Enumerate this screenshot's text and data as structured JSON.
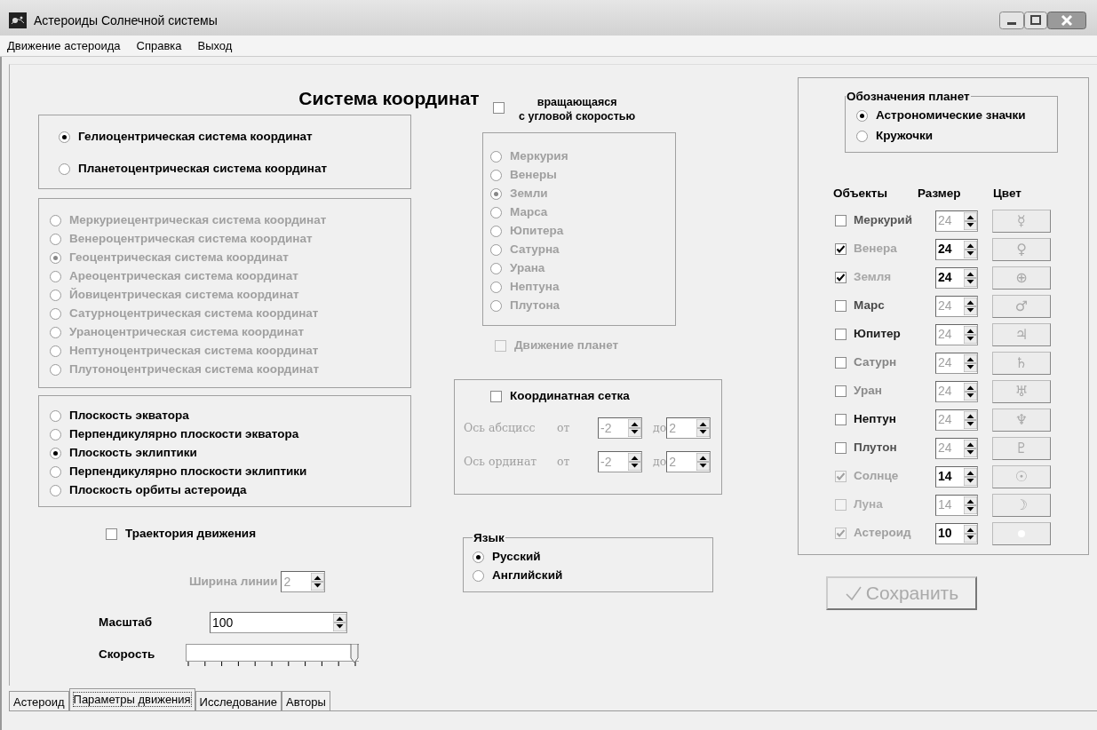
{
  "window": {
    "title": "Астероиды Солнечной системы"
  },
  "menu": [
    "Движение астероида",
    "Справка",
    "Выход"
  ],
  "heading": "Система координат",
  "center_group": {
    "options": [
      {
        "label": "Гелиоцентрическая система координат",
        "selected": true
      },
      {
        "label": "Планетоцентрическая система координат",
        "selected": false
      }
    ]
  },
  "planet_center_group": {
    "disabled": true,
    "options": [
      {
        "label": "Меркуриецентрическая система координат",
        "selected": false
      },
      {
        "label": "Венероцентрическая система координат",
        "selected": false
      },
      {
        "label": "Геоцентрическая система координат",
        "selected": true
      },
      {
        "label": "Ареоцентрическая система координат",
        "selected": false
      },
      {
        "label": "Йовицентрическая система координат",
        "selected": false
      },
      {
        "label": "Сатурноцентрическая система координат",
        "selected": false
      },
      {
        "label": "Ураноцентрическая система координат",
        "selected": false
      },
      {
        "label": "Нептуноцентрическая система координат",
        "selected": false
      },
      {
        "label": "Плутоноцентрическая система координат",
        "selected": false
      }
    ]
  },
  "plane_group": {
    "options": [
      {
        "label": "Плоскость экватора",
        "selected": false
      },
      {
        "label": "Перпендикулярно плоскости экватора",
        "selected": false
      },
      {
        "label": "Плоскость эклиптики",
        "selected": true
      },
      {
        "label": "Перпендикулярно плоскости эклиптики",
        "selected": false
      },
      {
        "label": "Плоскость орбиты астероида",
        "selected": false
      }
    ]
  },
  "trajectory": {
    "label": "Траектория движения",
    "checked": false
  },
  "line_width": {
    "label": "Ширина линии",
    "value": "2",
    "disabled": true
  },
  "scale": {
    "label": "Масштаб",
    "value": "100"
  },
  "speed": {
    "label": "Скорость",
    "level": 1
  },
  "rotating": {
    "label_lines": [
      "вращающаяся",
      "с угловой скоростью"
    ],
    "checked": false
  },
  "rotation_planets": {
    "disabled": true,
    "options": [
      {
        "label": "Меркурия",
        "selected": false
      },
      {
        "label": "Венеры",
        "selected": false
      },
      {
        "label": "Земли",
        "selected": true
      },
      {
        "label": "Марса",
        "selected": false
      },
      {
        "label": "Юпитера",
        "selected": false
      },
      {
        "label": "Сатурна",
        "selected": false
      },
      {
        "label": "Урана",
        "selected": false
      },
      {
        "label": "Нептуна",
        "selected": false
      },
      {
        "label": "Плутона",
        "selected": false
      }
    ]
  },
  "planet_motion": {
    "label": "Движение планет",
    "checked": false,
    "disabled": true
  },
  "grid": {
    "label": "Координатная сетка",
    "checked": false,
    "axes_disabled": true,
    "axes": [
      {
        "label": "Ось абсцисс",
        "from_label": "от",
        "from": "-2",
        "to_label": "до",
        "to": "2"
      },
      {
        "label": "Ось ординат",
        "from_label": "от",
        "from": "-2",
        "to_label": "до",
        "to": "2"
      }
    ]
  },
  "language": {
    "title": "Язык",
    "options": [
      {
        "label": "Русский",
        "selected": true
      },
      {
        "label": "Английский",
        "selected": false
      }
    ]
  },
  "planet_symbols": {
    "title": "Обозначения планет",
    "options": [
      {
        "label": "Астрономические значки",
        "selected": true
      },
      {
        "label": "Кружочки",
        "selected": false
      }
    ]
  },
  "objects": {
    "headers": [
      "Объекты",
      "Размер",
      "Цвет"
    ],
    "items": [
      {
        "name": "Меркурий",
        "checked": false,
        "disabled": false,
        "color": "#555555",
        "size": "24",
        "symbol": "☿"
      },
      {
        "name": "Венера",
        "checked": true,
        "disabled": false,
        "color": "#a4a4a4",
        "size": "24",
        "symbol": "♀"
      },
      {
        "name": "Земля",
        "checked": true,
        "disabled": false,
        "color": "#a8a8a8",
        "size": "24",
        "symbol": "⊕"
      },
      {
        "name": "Марс",
        "checked": false,
        "disabled": false,
        "color": "#4a4a4a",
        "size": "24",
        "symbol": "♂"
      },
      {
        "name": "Юпитер",
        "checked": false,
        "disabled": false,
        "color": "#1e1e1e",
        "size": "24",
        "symbol": "♃"
      },
      {
        "name": "Сатурн",
        "checked": false,
        "disabled": false,
        "color": "#858585",
        "size": "24",
        "symbol": "♄"
      },
      {
        "name": "Уран",
        "checked": false,
        "disabled": false,
        "color": "#8c8c8c",
        "size": "24",
        "symbol": "♅"
      },
      {
        "name": "Нептун",
        "checked": false,
        "disabled": false,
        "color": "#111111",
        "size": "24",
        "symbol": "♆"
      },
      {
        "name": "Плутон",
        "checked": false,
        "disabled": false,
        "color": "#505050",
        "size": "24",
        "symbol": "♇"
      },
      {
        "name": "Солнце",
        "checked": true,
        "disabled": true,
        "color": "#a2a2a2",
        "size": "14",
        "symbol": "☉"
      },
      {
        "name": "Луна",
        "checked": false,
        "disabled": true,
        "color": "#acacac",
        "size": "14",
        "symbol": "☽"
      },
      {
        "name": "Астероид",
        "checked": true,
        "disabled": true,
        "color": "#a0a0a0",
        "size": "10"
      }
    ]
  },
  "save_button": {
    "label": "Сохранить",
    "disabled": true
  },
  "tabs": [
    {
      "label": "Астероид",
      "selected": false
    },
    {
      "label": "Параметры движения",
      "selected": true
    },
    {
      "label": "Исследование",
      "selected": false
    },
    {
      "label": "Авторы",
      "selected": false
    }
  ]
}
